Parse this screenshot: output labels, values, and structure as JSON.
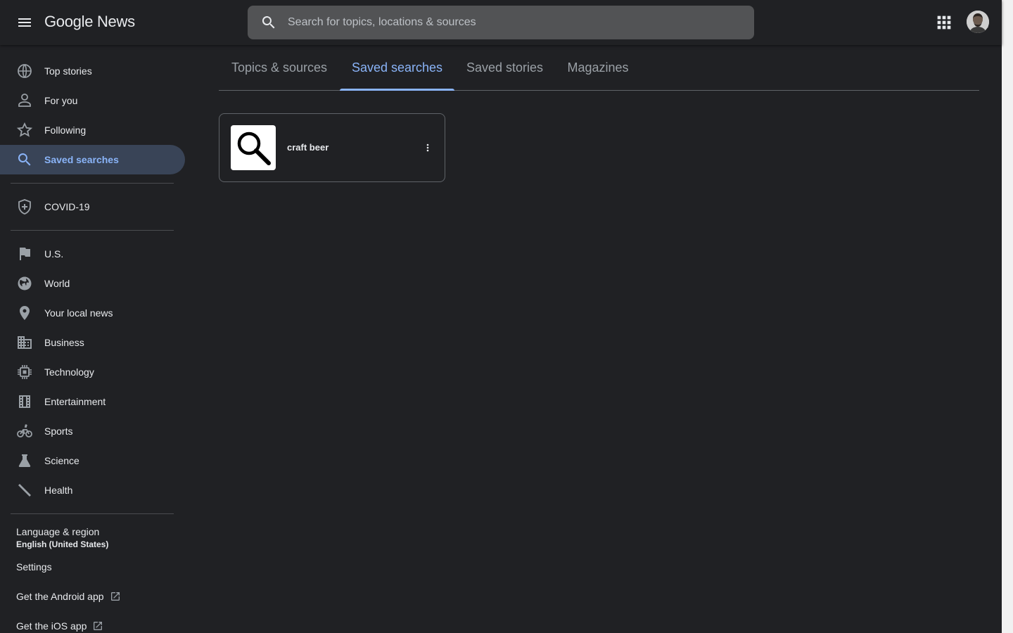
{
  "header": {
    "brand_google": "Google",
    "brand_news": "News",
    "search_placeholder": "Search for topics, locations & sources",
    "search_value": ""
  },
  "tabs": [
    {
      "label": "Topics & sources",
      "active": false
    },
    {
      "label": "Saved searches",
      "active": true
    },
    {
      "label": "Saved stories",
      "active": false
    },
    {
      "label": "Magazines",
      "active": false
    }
  ],
  "sidebar": {
    "items": [
      {
        "label": "Top stories",
        "icon": "globe-icon"
      },
      {
        "label": "For you",
        "icon": "person-icon"
      },
      {
        "label": "Following",
        "icon": "star-icon"
      },
      {
        "label": "Saved searches",
        "icon": "search-icon",
        "active": true
      },
      {
        "label": "COVID-19",
        "icon": "shield-icon"
      },
      {
        "label": "U.S.",
        "icon": "flag-icon"
      },
      {
        "label": "World",
        "icon": "world-icon"
      },
      {
        "label": "Your local news",
        "icon": "location-pin-icon"
      },
      {
        "label": "Business",
        "icon": "building-icon"
      },
      {
        "label": "Technology",
        "icon": "chip-icon"
      },
      {
        "label": "Entertainment",
        "icon": "film-icon"
      },
      {
        "label": "Sports",
        "icon": "bicycle-icon"
      },
      {
        "label": "Science",
        "icon": "flask-icon"
      },
      {
        "label": "Health",
        "icon": "dumbbell-icon"
      }
    ],
    "footer": {
      "language_label": "Language & region",
      "language_value": "English (United States)",
      "settings": "Settings",
      "android_app": "Get the Android app",
      "ios_app": "Get the iOS app"
    }
  },
  "saved_searches": [
    {
      "title": "craft beer",
      "icon": "magnifier-icon"
    }
  ],
  "colors": {
    "background": "#202124",
    "accent": "#8ab4f8",
    "active_bg": "#394457",
    "search_bg": "#525355"
  }
}
